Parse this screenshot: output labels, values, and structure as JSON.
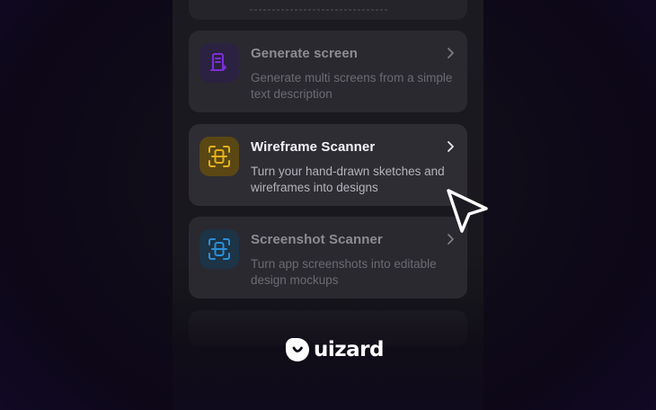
{
  "cards": [
    {
      "title": "Generate screen",
      "description": "Generate multi screens from a simple text description",
      "icon": "generate-screen-icon",
      "state": "muted"
    },
    {
      "title": "Wireframe Scanner",
      "description": "Turn your hand-drawn sketches and wireframes into designs",
      "icon": "wireframe-scan-icon",
      "state": "active"
    },
    {
      "title": "Screenshot Scanner",
      "description": "Turn app screenshots into editable design mockups",
      "icon": "screenshot-scan-icon",
      "state": "muted"
    }
  ],
  "brand": {
    "name": "uizard"
  },
  "colors": {
    "generate_icon": "#7b2fd6",
    "wireframe_icon": "#e4b21a",
    "screenshot_icon": "#2a8fd6"
  }
}
